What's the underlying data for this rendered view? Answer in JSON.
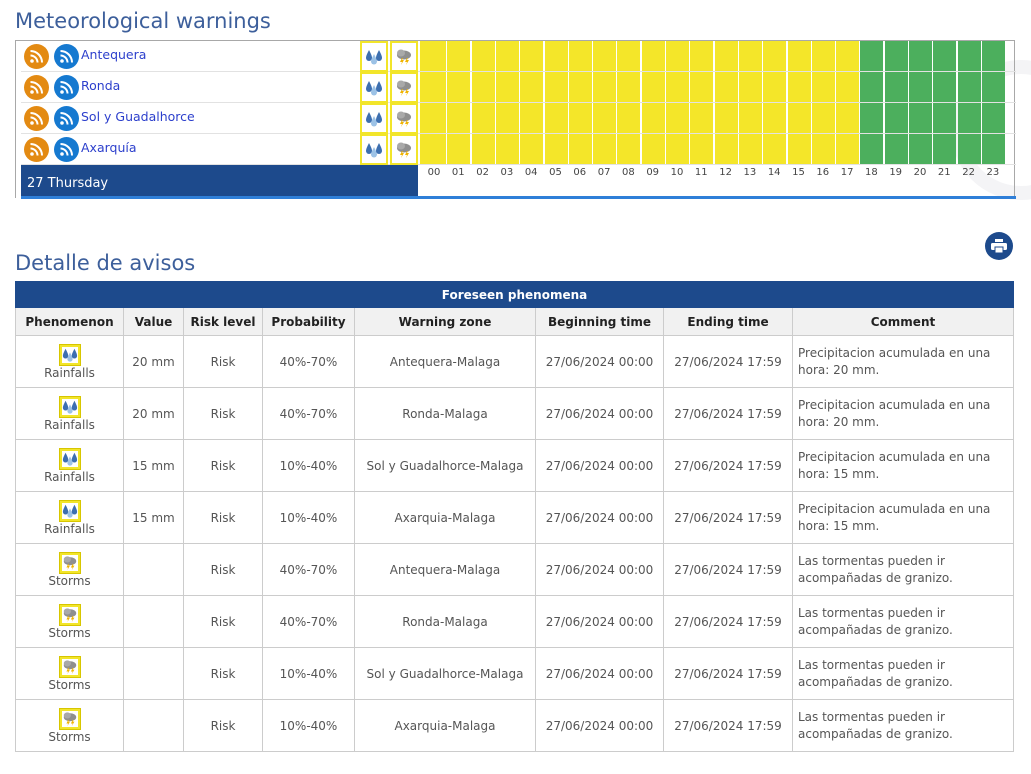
{
  "warnings": {
    "title": "Meteorological warnings",
    "zones": [
      {
        "name": "Antequera",
        "icons": [
          "rain-icon",
          "storm-icon"
        ]
      },
      {
        "name": "Ronda",
        "icons": [
          "rain-icon",
          "storm-icon"
        ]
      },
      {
        "name": "Sol y Guadalhorce",
        "icons": [
          "rain-icon",
          "storm-icon"
        ]
      },
      {
        "name": "Axarquía",
        "icons": [
          "rain-icon",
          "storm-icon"
        ]
      }
    ],
    "day_label": "27 Thursday",
    "hours": [
      "00",
      "01",
      "02",
      "03",
      "04",
      "05",
      "06",
      "07",
      "08",
      "09",
      "10",
      "11",
      "12",
      "13",
      "14",
      "15",
      "16",
      "17",
      "18",
      "19",
      "20",
      "21",
      "22",
      "23"
    ],
    "hour_levels": [
      "yellow",
      "yellow",
      "yellow",
      "yellow",
      "yellow",
      "yellow",
      "yellow",
      "yellow",
      "yellow",
      "yellow",
      "yellow",
      "yellow",
      "yellow",
      "yellow",
      "yellow",
      "yellow",
      "yellow",
      "yellow",
      "green",
      "green",
      "green",
      "green",
      "green",
      "green"
    ],
    "level_colors": {
      "yellow": "#f4e629",
      "green": "#4caf5d"
    }
  },
  "detail": {
    "title": "Detalle de avisos",
    "print_icon": "printer-icon",
    "caption": "Foreseen phenomena",
    "columns": [
      "Phenomenon",
      "Value",
      "Risk level",
      "Probability",
      "Warning zone",
      "Beginning time",
      "Ending time",
      "Comment"
    ],
    "rows": [
      {
        "phenomenon": "Rainfalls",
        "icon": "rain-icon",
        "value": "20 mm",
        "risk": "Risk",
        "probability": "40%-70%",
        "zone": "Antequera-Malaga",
        "begin": "27/06/2024 00:00",
        "end": "27/06/2024 17:59",
        "comment": "Precipitacion acumulada en una hora: 20 mm."
      },
      {
        "phenomenon": "Rainfalls",
        "icon": "rain-icon",
        "value": "20 mm",
        "risk": "Risk",
        "probability": "40%-70%",
        "zone": "Ronda-Malaga",
        "begin": "27/06/2024 00:00",
        "end": "27/06/2024 17:59",
        "comment": "Precipitacion acumulada en una hora: 20 mm."
      },
      {
        "phenomenon": "Rainfalls",
        "icon": "rain-icon",
        "value": "15 mm",
        "risk": "Risk",
        "probability": "10%-40%",
        "zone": "Sol y Guadalhorce-Malaga",
        "begin": "27/06/2024 00:00",
        "end": "27/06/2024 17:59",
        "comment": "Precipitacion acumulada en una hora: 15 mm."
      },
      {
        "phenomenon": "Rainfalls",
        "icon": "rain-icon",
        "value": "15 mm",
        "risk": "Risk",
        "probability": "10%-40%",
        "zone": "Axarquia-Malaga",
        "begin": "27/06/2024 00:00",
        "end": "27/06/2024 17:59",
        "comment": "Precipitacion acumulada en una hora: 15 mm."
      },
      {
        "phenomenon": "Storms",
        "icon": "storm-icon",
        "value": "",
        "risk": "Risk",
        "probability": "40%-70%",
        "zone": "Antequera-Malaga",
        "begin": "27/06/2024 00:00",
        "end": "27/06/2024 17:59",
        "comment": "Las tormentas pueden ir acompañadas de granizo."
      },
      {
        "phenomenon": "Storms",
        "icon": "storm-icon",
        "value": "",
        "risk": "Risk",
        "probability": "40%-70%",
        "zone": "Ronda-Malaga",
        "begin": "27/06/2024 00:00",
        "end": "27/06/2024 17:59",
        "comment": "Las tormentas pueden ir acompañadas de granizo."
      },
      {
        "phenomenon": "Storms",
        "icon": "storm-icon",
        "value": "",
        "risk": "Risk",
        "probability": "10%-40%",
        "zone": "Sol y Guadalhorce-Malaga",
        "begin": "27/06/2024 00:00",
        "end": "27/06/2024 17:59",
        "comment": "Las tormentas pueden ir acompañadas de granizo."
      },
      {
        "phenomenon": "Storms",
        "icon": "storm-icon",
        "value": "",
        "risk": "Risk",
        "probability": "10%-40%",
        "zone": "Axarquia-Malaga",
        "begin": "27/06/2024 00:00",
        "end": "27/06/2024 17:59",
        "comment": "Las tormentas pueden ir acompañadas de granizo."
      }
    ]
  }
}
